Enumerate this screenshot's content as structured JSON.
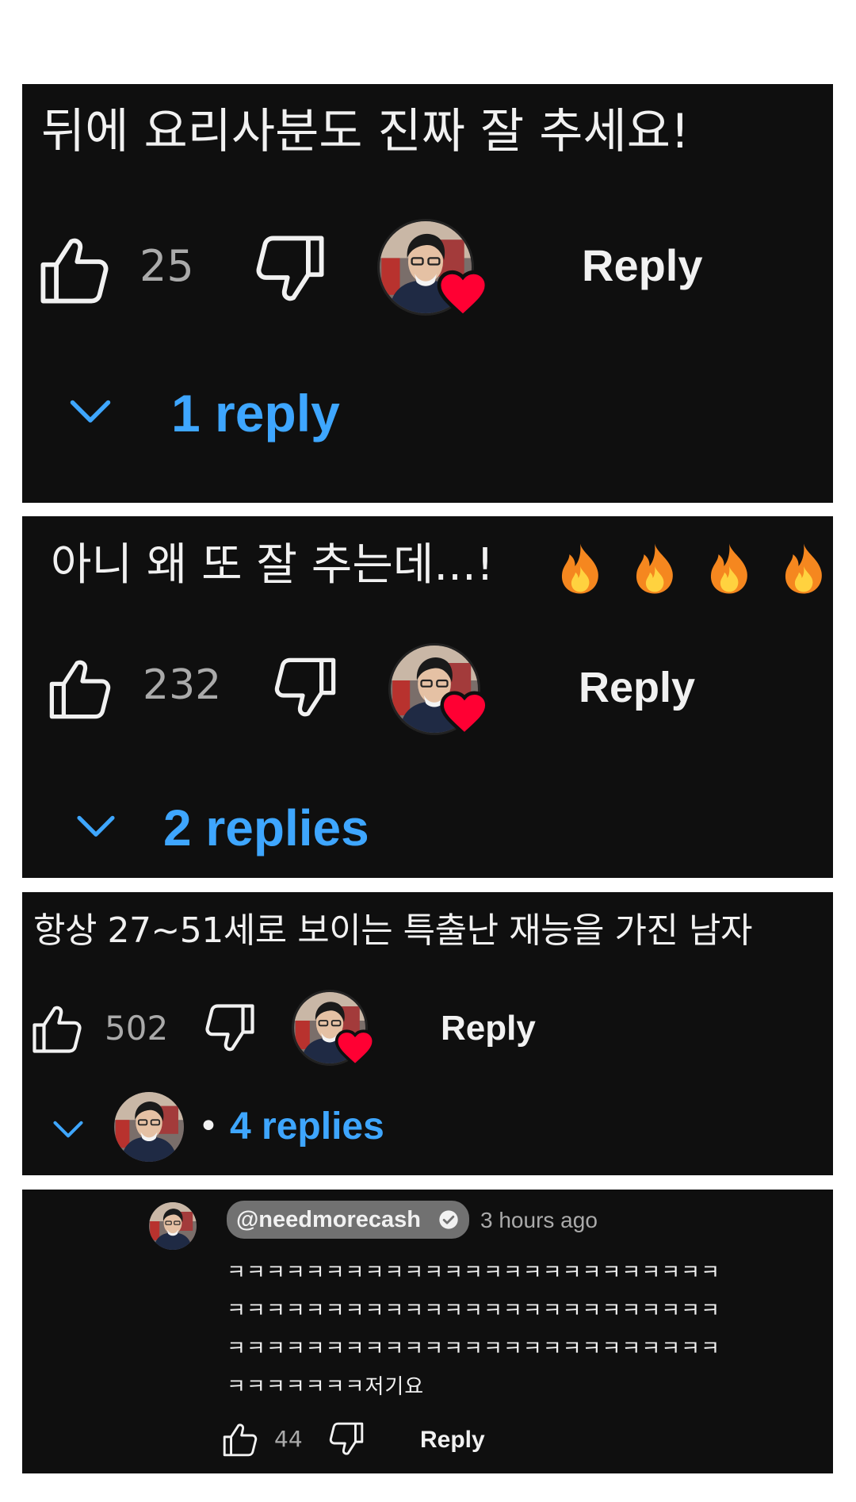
{
  "comments": [
    {
      "text": "뒤에 요리사분도 진짜 잘 추세요!",
      "likes": "25",
      "reply_label": "Reply",
      "replies_label": "1 reply",
      "creator_hearted": true
    },
    {
      "text": "아니 왜 또 잘 추는데...!",
      "emojis": [
        "🔥",
        "🔥",
        "🔥",
        "🔥"
      ],
      "likes": "232",
      "reply_label": "Reply",
      "replies_label": "2 replies",
      "creator_hearted": true
    },
    {
      "text": "항상 27~51세로 보이는 특출난 재능을 가진 남자",
      "likes": "502",
      "reply_label": "Reply",
      "replies_separator": "•",
      "replies_label": "4 replies",
      "creator_hearted": true
    }
  ],
  "reply": {
    "author": "@needmorecash",
    "verified_icon": "check-circle-icon",
    "time": "3 hours ago",
    "lines": [
      "ㅋㅋㅋㅋㅋㅋㅋㅋㅋㅋㅋㅋㅋㅋㅋㅋㅋㅋㅋㅋㅋㅋㅋㅋㅋ",
      "ㅋㅋㅋㅋㅋㅋㅋㅋㅋㅋㅋㅋㅋㅋㅋㅋㅋㅋㅋㅋㅋㅋㅋㅋㅋ",
      "ㅋㅋㅋㅋㅋㅋㅋㅋㅋㅋㅋㅋㅋㅋㅋㅋㅋㅋㅋㅋㅋㅋㅋㅋㅋ",
      "ㅋㅋㅋㅋㅋㅋㅋ저기요"
    ],
    "likes": "44",
    "reply_label": "Reply"
  },
  "colors": {
    "background": "#0f0f0f",
    "text": "#f1f1f1",
    "secondary": "#aaaaaa",
    "link": "#3ea6ff",
    "heart": "#ff0033",
    "badge": "#717171"
  },
  "icons": [
    "thumbs-up-icon",
    "thumbs-down-icon",
    "chevron-down-icon",
    "heart-icon",
    "fire-emoji",
    "avatar"
  ]
}
